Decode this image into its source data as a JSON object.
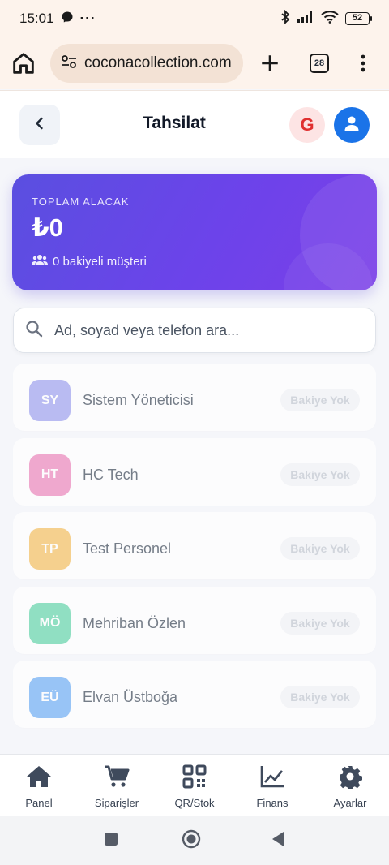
{
  "status_bar": {
    "time": "15:01",
    "battery": "52",
    "icons": [
      "messenger-icon",
      "more-icon",
      "bluetooth-icon",
      "signal-icon",
      "wifi-icon",
      "battery-icon"
    ]
  },
  "browser": {
    "url": "coconacollection.com",
    "tab_count": "28",
    "icons": [
      "home-icon",
      "site-settings-icon",
      "new-tab-icon",
      "tabs-icon",
      "menu-icon"
    ]
  },
  "header": {
    "title": "Tahsilat",
    "g_avatar": "G"
  },
  "summary": {
    "label": "TOPLAM ALACAK",
    "amount": "₺0",
    "customers_text": "0 bakiyeli müşteri"
  },
  "search": {
    "placeholder": "Ad, soyad veya telefon ara..."
  },
  "customers": [
    {
      "initials": "SY",
      "name": "Sistem Yöneticisi",
      "status": "Bakiye Yok",
      "color": "#a5a8f0"
    },
    {
      "initials": "HT",
      "name": "HC Tech",
      "status": "Bakiye Yok",
      "color": "#ee8fc0"
    },
    {
      "initials": "TP",
      "name": "Test Personel",
      "status": "Bakiye Yok",
      "color": "#f5c46a"
    },
    {
      "initials": "MÖ",
      "name": "Mehriban Özlen",
      "status": "Bakiye Yok",
      "color": "#6fd8b0"
    },
    {
      "initials": "EÜ",
      "name": "Elvan Üstboğa",
      "status": "Bakiye Yok",
      "color": "#7ab4f5"
    }
  ],
  "bottom_nav": [
    {
      "label": "Panel",
      "icon": "home-icon"
    },
    {
      "label": "Siparişler",
      "icon": "cart-icon"
    },
    {
      "label": "QR/Stok",
      "icon": "qr-icon"
    },
    {
      "label": "Finans",
      "icon": "chart-icon"
    },
    {
      "label": "Ayarlar",
      "icon": "gear-icon"
    }
  ],
  "colors": {
    "accent": "#6c43ea",
    "primary_blue": "#1a73e8",
    "nav_icon": "#374151"
  }
}
